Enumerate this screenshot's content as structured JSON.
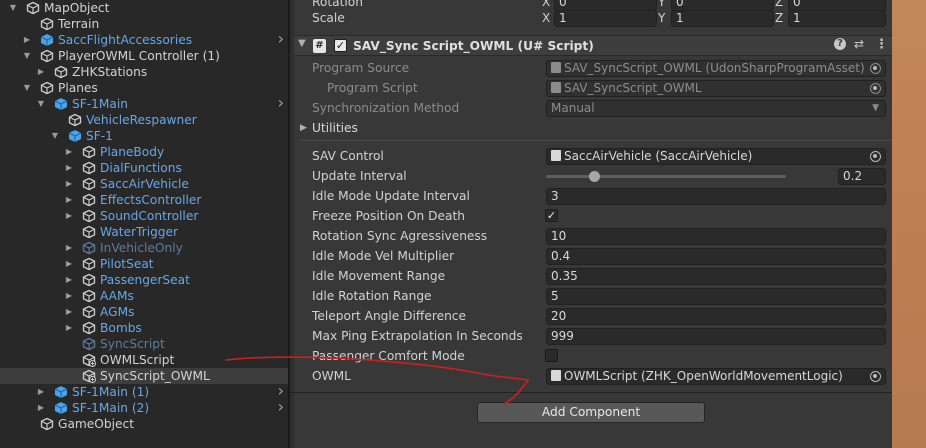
{
  "hierarchy": {
    "rows": [
      {
        "label": "MapObject",
        "depth": 0,
        "arrow": "down",
        "icon": "go",
        "color": "def"
      },
      {
        "label": "Terrain",
        "depth": 1,
        "arrow": "",
        "icon": "go",
        "color": "def"
      },
      {
        "label": "SaccFlightAccessories",
        "depth": 1,
        "arrow": "right",
        "icon": "prefab",
        "color": "pre",
        "chev": true
      },
      {
        "label": "PlayerOWML Controller (1)",
        "depth": 1,
        "arrow": "down",
        "icon": "go",
        "color": "def"
      },
      {
        "label": "ZHKStations",
        "depth": 2,
        "arrow": "right",
        "icon": "go",
        "color": "def"
      },
      {
        "label": "Planes",
        "depth": 1,
        "arrow": "down",
        "icon": "go",
        "color": "def"
      },
      {
        "label": "SF-1Main",
        "depth": 2,
        "arrow": "down",
        "icon": "prefab",
        "color": "pre",
        "chev": true
      },
      {
        "label": "VehicleRespawner",
        "depth": 3,
        "arrow": "",
        "icon": "prefab-o",
        "color": "pre"
      },
      {
        "label": "SF-1",
        "depth": 3,
        "arrow": "down",
        "icon": "prefab",
        "color": "pre"
      },
      {
        "label": "PlaneBody",
        "depth": 4,
        "arrow": "right",
        "icon": "prefab-o",
        "color": "pre"
      },
      {
        "label": "DialFunctions",
        "depth": 4,
        "arrow": "right",
        "icon": "prefab-o",
        "color": "pre"
      },
      {
        "label": "SaccAirVehicle",
        "depth": 4,
        "arrow": "right",
        "icon": "prefab-o",
        "color": "pre"
      },
      {
        "label": "EffectsController",
        "depth": 4,
        "arrow": "right",
        "icon": "prefab-o",
        "color": "pre"
      },
      {
        "label": "SoundController",
        "depth": 4,
        "arrow": "right",
        "icon": "prefab-o",
        "color": "pre"
      },
      {
        "label": "WaterTrigger",
        "depth": 4,
        "arrow": "",
        "icon": "prefab-o",
        "color": "pre"
      },
      {
        "label": "InVehicleOnly",
        "depth": 4,
        "arrow": "right",
        "icon": "prefab-o",
        "color": "dis"
      },
      {
        "label": "PilotSeat",
        "depth": 4,
        "arrow": "right",
        "icon": "prefab-o",
        "color": "pre"
      },
      {
        "label": "PassengerSeat",
        "depth": 4,
        "arrow": "right",
        "icon": "prefab-o",
        "color": "pre"
      },
      {
        "label": "AAMs",
        "depth": 4,
        "arrow": "right",
        "icon": "prefab-o",
        "color": "pre"
      },
      {
        "label": "AGMs",
        "depth": 4,
        "arrow": "right",
        "icon": "prefab-o",
        "color": "pre"
      },
      {
        "label": "Bombs",
        "depth": 4,
        "arrow": "right",
        "icon": "prefab-o",
        "color": "pre"
      },
      {
        "label": "SyncScript",
        "depth": 4,
        "arrow": "",
        "icon": "prefab-o",
        "color": "dis"
      },
      {
        "label": "OWMLScript",
        "depth": 4,
        "arrow": "",
        "icon": "go-plus",
        "color": "def"
      },
      {
        "label": "SyncScript_OWML",
        "depth": 4,
        "arrow": "",
        "icon": "go-plus",
        "color": "def",
        "selected": true
      },
      {
        "label": "SF-1Main (1)",
        "depth": 2,
        "arrow": "right",
        "icon": "prefab",
        "color": "pre",
        "chev": true
      },
      {
        "label": "SF-1Main (2)",
        "depth": 2,
        "arrow": "right",
        "icon": "prefab",
        "color": "pre",
        "chev": true
      },
      {
        "label": "GameObject",
        "depth": 1,
        "arrow": "",
        "icon": "go",
        "color": "def"
      }
    ]
  },
  "transform": {
    "rotation_label": "Rotation",
    "scale_label": "Scale",
    "x_label": "X",
    "y_label": "Y",
    "z_label": "Z",
    "rot_x": "0",
    "rot_y": "0",
    "rot_z": "0",
    "scale_x": "1",
    "scale_y": "1",
    "scale_z": "1"
  },
  "component": {
    "title": "SAV_Sync Script_OWML (U# Script)",
    "program_source_label": "Program Source",
    "program_source_value": "SAV_SyncScript_OWML (UdonSharpProgramAsset)",
    "program_script_label": "Program Script",
    "program_script_value": "SAV_SyncScript_OWML",
    "sync_method_label": "Synchronization Method",
    "sync_method_value": "Manual",
    "utilities_label": "Utilities"
  },
  "properties": [
    {
      "label": "SAV Control",
      "type": "object",
      "value": "SaccAirVehicle (SaccAirVehicle)"
    },
    {
      "label": "Update Interval",
      "type": "slider",
      "value": "0.2",
      "fraction": 0.2
    },
    {
      "label": "Idle Mode Update Interval",
      "type": "text",
      "value": "3"
    },
    {
      "label": "Freeze Position On Death",
      "type": "check",
      "checked": true
    },
    {
      "label": "Rotation Sync Agressiveness",
      "type": "text",
      "value": "10"
    },
    {
      "label": "Idle Mode Vel Multiplier",
      "type": "text",
      "value": "0.4"
    },
    {
      "label": "Idle Movement Range",
      "type": "text",
      "value": "0.35"
    },
    {
      "label": "Idle Rotation Range",
      "type": "text",
      "value": "5"
    },
    {
      "label": "Teleport Angle Difference",
      "type": "text",
      "value": "20"
    },
    {
      "label": "Max Ping Extrapolation In Seconds",
      "type": "text",
      "value": "999"
    },
    {
      "label": "Passenger Comfort Mode",
      "type": "check",
      "checked": false
    },
    {
      "label": "OWML",
      "type": "object",
      "value": "OWMLScript (ZHK_OpenWorldMovementLogic)"
    }
  ],
  "add_component_label": "Add Component",
  "colors": {
    "annotation": "#d11d1d",
    "prefab": "#67a6e8",
    "panel": "#383838",
    "hierarchy_bg": "#282828"
  }
}
